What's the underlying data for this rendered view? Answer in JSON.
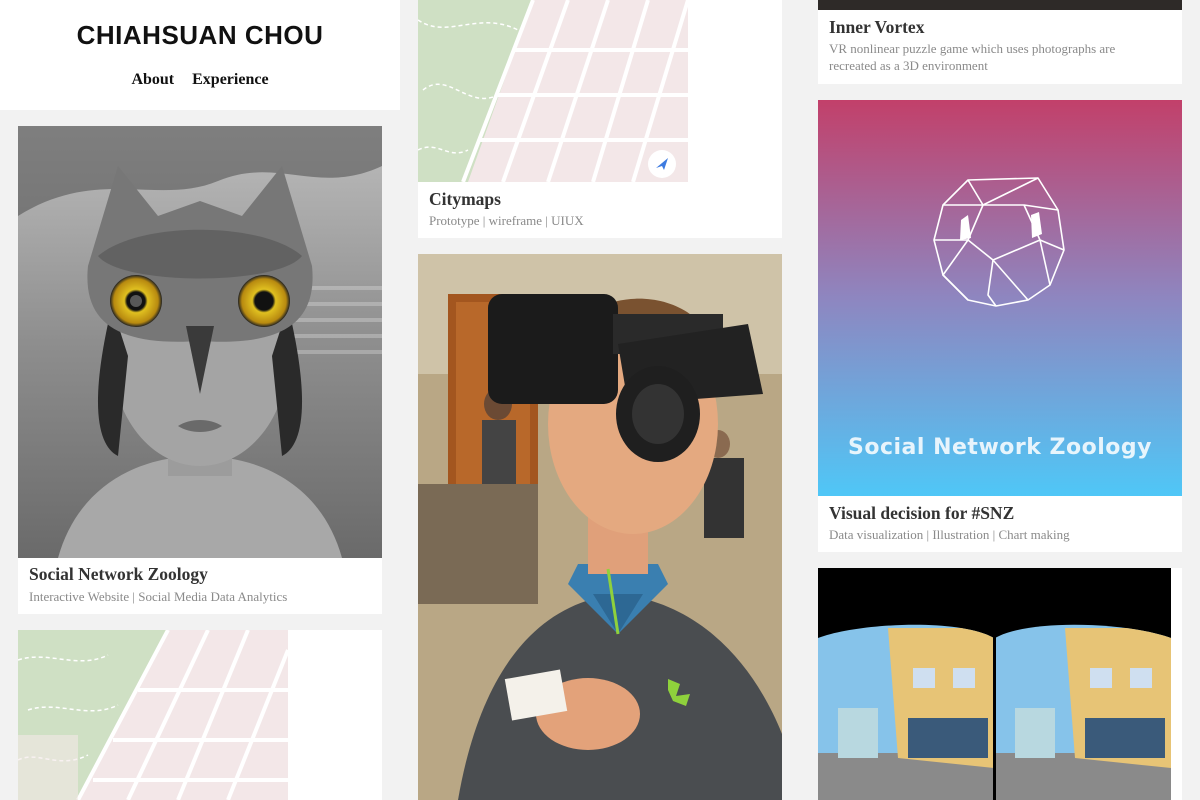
{
  "header": {
    "site_title": "CHIAHSUAN CHOU",
    "nav": [
      {
        "label": "About"
      },
      {
        "label": "Experience"
      }
    ]
  },
  "cards": {
    "snz": {
      "title": "Social Network Zoology",
      "subtitle": "Interactive Website | Social Media Data Analytics"
    },
    "citymaps": {
      "title": "Citymaps",
      "subtitle": "Prototype | wireframe | UIUX"
    },
    "inner_vortex": {
      "title": "Inner Vortex",
      "subtitle_line1": "VR nonlinear puzzle game which uses photographs are",
      "subtitle_line2": "recreated as a 3D environment"
    },
    "visual_snz": {
      "title": "Visual decision for #SNZ",
      "subtitle": "Data visualization | Illustration | Chart making",
      "art_text": "Social Network Zoology"
    }
  },
  "colors": {
    "map_green": "#cfe0c4",
    "map_block": "#f3e7e8",
    "gradient_top": "#c2406a",
    "gradient_bottom": "#4fc7f7"
  }
}
